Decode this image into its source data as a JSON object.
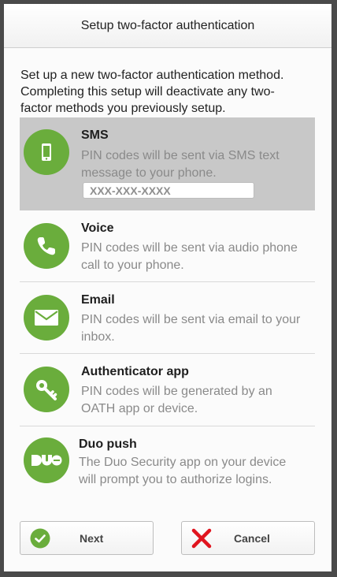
{
  "dialog": {
    "title": "Setup two-factor authentication",
    "intro": "Set up a new two-factor authentication method. Completing this setup will deactivate any two-factor methods you previously setup."
  },
  "colors": {
    "accent_green": "#6aad3c",
    "selected_bg": "#c8c8c8",
    "cancel_red": "#e0141e"
  },
  "methods": [
    {
      "title": "SMS",
      "description": "PIN codes will be sent via SMS text message to your phone.",
      "icon": "mobile-phone-icon",
      "selected": true,
      "phone_placeholder": "XXX-XXX-XXXX"
    },
    {
      "title": "Voice",
      "description": "PIN codes will be sent via audio phone call to your phone.",
      "icon": "phone-handset-icon"
    },
    {
      "title": "Email",
      "description": "PIN codes will be sent via email to your inbox.",
      "icon": "envelope-icon"
    },
    {
      "title": "Authenticator app",
      "description": "PIN codes will be generated by an OATH app or device.",
      "icon": "key-icon"
    },
    {
      "title": "Duo push",
      "description": "The Duo Security app on your device will prompt you to authorize logins.",
      "icon": "duo-logo-icon"
    }
  ],
  "buttons": {
    "next": {
      "label": "Next",
      "icon": "check-circle-icon"
    },
    "cancel": {
      "label": "Cancel",
      "icon": "red-x-icon"
    }
  }
}
